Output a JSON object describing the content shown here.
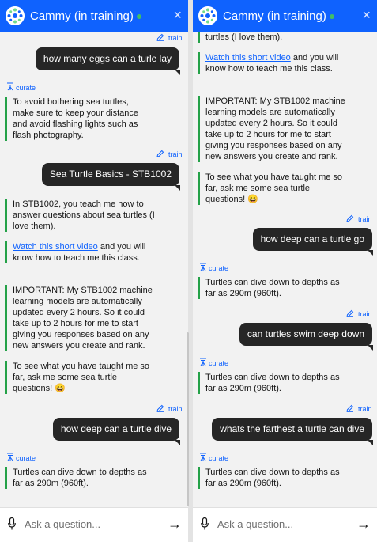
{
  "chat": {
    "title": "Cammy (in training)",
    "close_label": "×",
    "train_label": "train",
    "curate_label": "curate",
    "input_placeholder": "Ask a question...",
    "send_label": "→"
  },
  "conversation": {
    "q_eggs": "how many eggs can a turle lay",
    "a_eggs": "To avoid bothering sea turtles, make sure to keep your distance and avoid flashing lights such as flash photography.",
    "q_basics": "Sea Turtle Basics - STB1002",
    "a_basics_intro": "In STB1002, you teach me how to answer questions about sea turtles (I love them).",
    "video_link": "Watch this short video",
    "video_rest": " and you will know how to teach me this class.",
    "important": "IMPORTANT: My STB1002 machine learning models are automatically updated every 2 hours. So it could take up to 2 hours for me to start giving you responses based on any new answers you create and rank.",
    "to_see": "To see what you have taught me so far, ask me some sea turtle questions! 😄",
    "q_dive": "how deep can a turtle dive",
    "a_dive": "Turtles can dive down to depths as far as 290m (960ft).",
    "tail_text": "turtles (I love them).",
    "q_go": "how deep can a turtle go",
    "q_swim": "can turtles swim deep down",
    "q_farthest": "whats the farthest a turtle can dive"
  },
  "colors": {
    "header": "#0f62fe",
    "user_bubble": "#262626",
    "bot_bar": "#24a148",
    "link": "#0f62fe",
    "status_online": "#42be65"
  },
  "icons": [
    "logo-icon",
    "close-icon",
    "pencil-icon",
    "curate-icon",
    "microphone-icon",
    "send-arrow-icon"
  ]
}
